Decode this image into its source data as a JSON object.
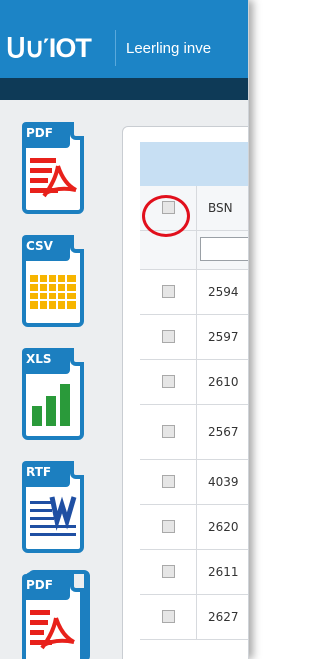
{
  "header": {
    "logo_text": "ᑌ∪ΊΟΤ",
    "app_title": "Leerling inve"
  },
  "toolbar": {
    "buttons": [
      {
        "ext": "PDF",
        "icon": "pdf-icon"
      },
      {
        "ext": "CSV",
        "icon": "csv-icon"
      },
      {
        "ext": "XLS",
        "icon": "xls-icon"
      },
      {
        "ext": "RTF",
        "icon": "rtf-icon"
      },
      {
        "ext": "PDF",
        "icon": "pdf-batch-icon"
      }
    ]
  },
  "table": {
    "column_header": "BSN",
    "rows": [
      "2594",
      "2597",
      "2610",
      "2567",
      "4039",
      "2620",
      "2611",
      "2627"
    ]
  },
  "colors": {
    "topbar": "#1c84c6",
    "navband": "#0e3a57",
    "grid_header": "#c7dff3",
    "highlight_ring": "#e10f1c"
  }
}
